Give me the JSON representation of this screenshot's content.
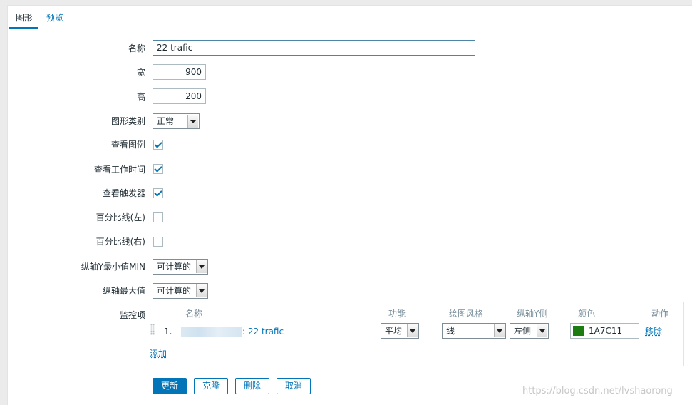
{
  "tabs": [
    {
      "label": "图形",
      "active": true
    },
    {
      "label": "预览",
      "active": false
    }
  ],
  "form": {
    "name_label": "名称",
    "name_value": "22 trafic",
    "width_label": "宽",
    "width_value": "900",
    "height_label": "高",
    "height_value": "200",
    "graph_type_label": "图形类别",
    "graph_type_value": "正常",
    "show_legend_label": "查看图例",
    "show_legend_checked": true,
    "show_worktime_label": "查看工作时间",
    "show_worktime_checked": true,
    "show_triggers_label": "查看触发器",
    "show_triggers_checked": true,
    "percentile_left_label": "百分比线(左)",
    "percentile_left_checked": false,
    "percentile_right_label": "百分比线(右)",
    "percentile_right_checked": false,
    "ymin_label": "纵轴Y最小值MIN",
    "ymin_value": "可计算的",
    "ymax_label": "纵轴最大值",
    "ymax_value": "可计算的",
    "items_label": "监控项"
  },
  "items_table": {
    "headers": {
      "name": "名称",
      "function": "功能",
      "draw_style": "绘图风格",
      "y_axis_side": "纵轴Y侧",
      "color": "颜色",
      "action": "动作"
    },
    "rows": [
      {
        "index": "1.",
        "name": ": 22 trafic",
        "function": "平均",
        "draw_style": "线",
        "y_axis_side": "左侧",
        "color_hex": "1A7C11",
        "color": "#1A7C11",
        "action": "移除"
      }
    ],
    "add_link": "添加"
  },
  "buttons": {
    "update": "更新",
    "clone": "克隆",
    "delete": "删除",
    "cancel": "取消"
  },
  "watermark": "https://blog.csdn.net/lvshaorong",
  "colors": {
    "accent": "#0275b8",
    "border": "#acbbc2",
    "item_color": "#1A7C11"
  }
}
